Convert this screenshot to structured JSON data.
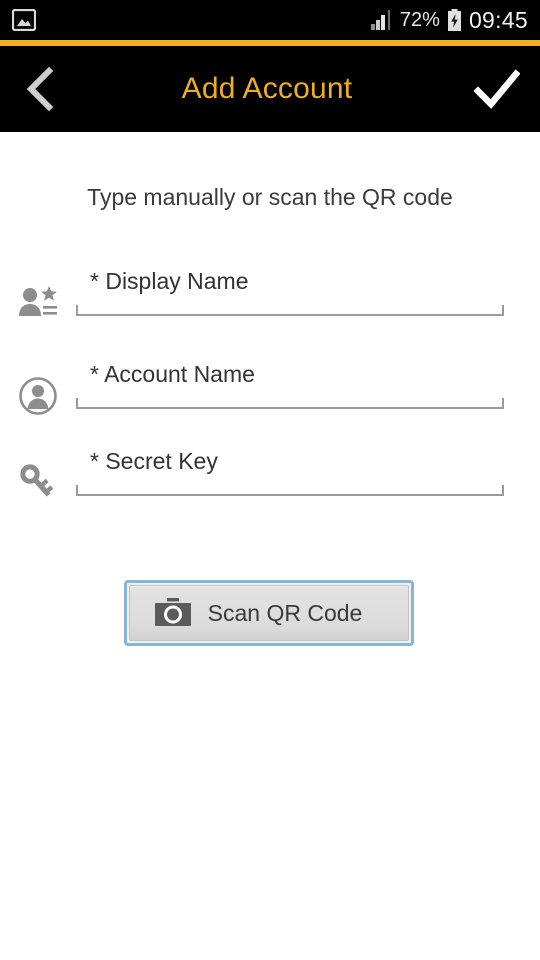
{
  "status_bar": {
    "notification_icon": "gallery-icon",
    "signal_icon": "signal-bars-icon",
    "battery_percent": "72%",
    "battery_icon": "battery-charging-icon",
    "time": "09:45"
  },
  "header": {
    "back_icon": "chevron-left-icon",
    "title": "Add Account",
    "confirm_icon": "checkmark-icon",
    "accent_color": "#efae1c",
    "background_color": "#000000"
  },
  "main": {
    "instruction": "Type manually or scan the QR code",
    "fields": [
      {
        "label": "* Display Name",
        "value": "",
        "icon": "contact-star-icon"
      },
      {
        "label": "* Account Name",
        "value": "",
        "icon": "account-circle-icon"
      },
      {
        "label": "* Secret Key",
        "value": "",
        "icon": "key-icon"
      }
    ],
    "scan_button": {
      "label": "Scan QR Code",
      "icon": "camera-icon",
      "focus_color": "#86b5d6"
    }
  }
}
